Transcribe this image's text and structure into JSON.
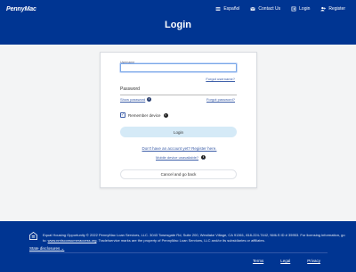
{
  "header": {
    "logo": "PennyMac",
    "title": "Login",
    "links": [
      {
        "label": "Español",
        "icon": "flag-icon"
      },
      {
        "label": "Contact Us",
        "icon": "mail-icon"
      },
      {
        "label": "Login",
        "icon": "login-icon"
      },
      {
        "label": "Register",
        "icon": "register-icon"
      }
    ]
  },
  "form": {
    "username_label": "Username",
    "username_value": "",
    "forgot_username": "Forgot username?",
    "password_label": "Password",
    "show_password": "Show password",
    "forgot_password": "Forgot password?",
    "remember_device": "Remember device",
    "remember_checked": true,
    "login_button": "Login",
    "register_link": "Don't have an account yet? Register here.",
    "mobile_link": "Mobile device unavailable?",
    "cancel_button": "Cancel and go back"
  },
  "footer": {
    "text_before_link": "Equal Housing Opportunity © 2022 PennyMac Loan Services, LLC. 3043 Townsgate Rd, Suite 200, Westlake Village, CA 91361, 818-224-7442, NMLS ID # 35953. For licensing information, go to: ",
    "link_text": "www.nmlsconsumeraccess.org",
    "text_after_link": ". Trade/service marks are the property of PennyMac Loan Services, LLC and/or its subsidiaries or affiliates.",
    "state_disclosures": "State disclosures",
    "links": [
      "Terms",
      "Legal",
      "Privacy"
    ]
  },
  "colors": {
    "brand_blue": "#003592",
    "login_button": "#d5eaf7"
  }
}
